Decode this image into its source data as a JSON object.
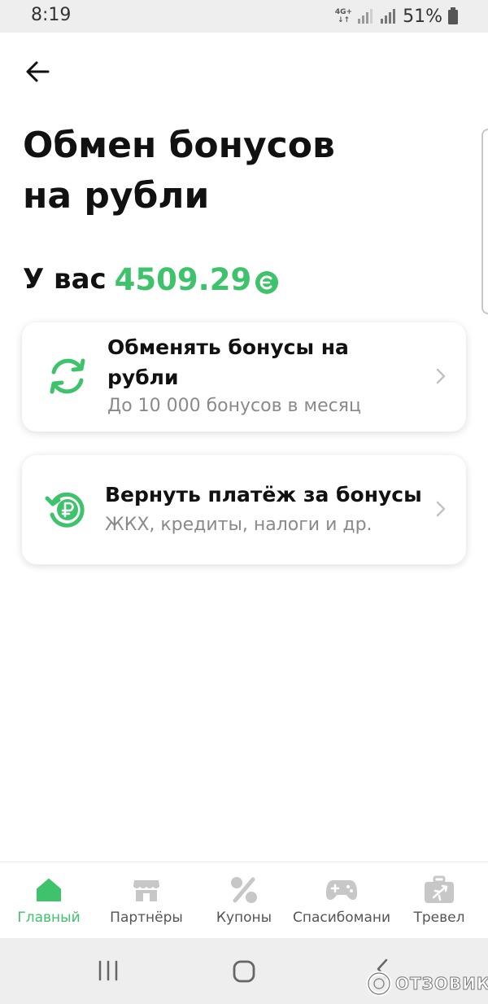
{
  "status_bar": {
    "time": "8:19",
    "network": "4G+",
    "battery_percent": "51%"
  },
  "header": {
    "back_icon": "arrow-left-icon",
    "title_line1": "Обмен бонусов",
    "title_line2": "на рубли"
  },
  "balance": {
    "label": "У вас",
    "value": "4509.29",
    "currency_icon": "bonus-coin-icon"
  },
  "cards": [
    {
      "icon": "exchange-arrows-icon",
      "title": "Обменять бонусы на рубли",
      "subtitle": "До 10 000 бонусов в месяц"
    },
    {
      "icon": "ruble-refund-icon",
      "title": "Вернуть платёж за бонусы",
      "subtitle": "ЖКХ, кредиты, налоги и др."
    }
  ],
  "bottom_nav": {
    "items": [
      {
        "label": "Главный",
        "icon": "home-icon",
        "active": true
      },
      {
        "label": "Партнёры",
        "icon": "store-icon",
        "active": false
      },
      {
        "label": "Купоны",
        "icon": "percent-icon",
        "active": false
      },
      {
        "label": "Спасибомани",
        "icon": "gamepad-icon",
        "active": false
      },
      {
        "label": "Тревел",
        "icon": "suitcase-plane-icon",
        "active": false
      }
    ]
  },
  "watermark": {
    "text": "ОТЗОВИК"
  },
  "colors": {
    "accent_green": "#3ec26b",
    "text_primary": "#111111",
    "text_secondary": "#8a8a8a",
    "nav_inactive": "#c7c7c7",
    "system_bar": "#eeeeee"
  }
}
